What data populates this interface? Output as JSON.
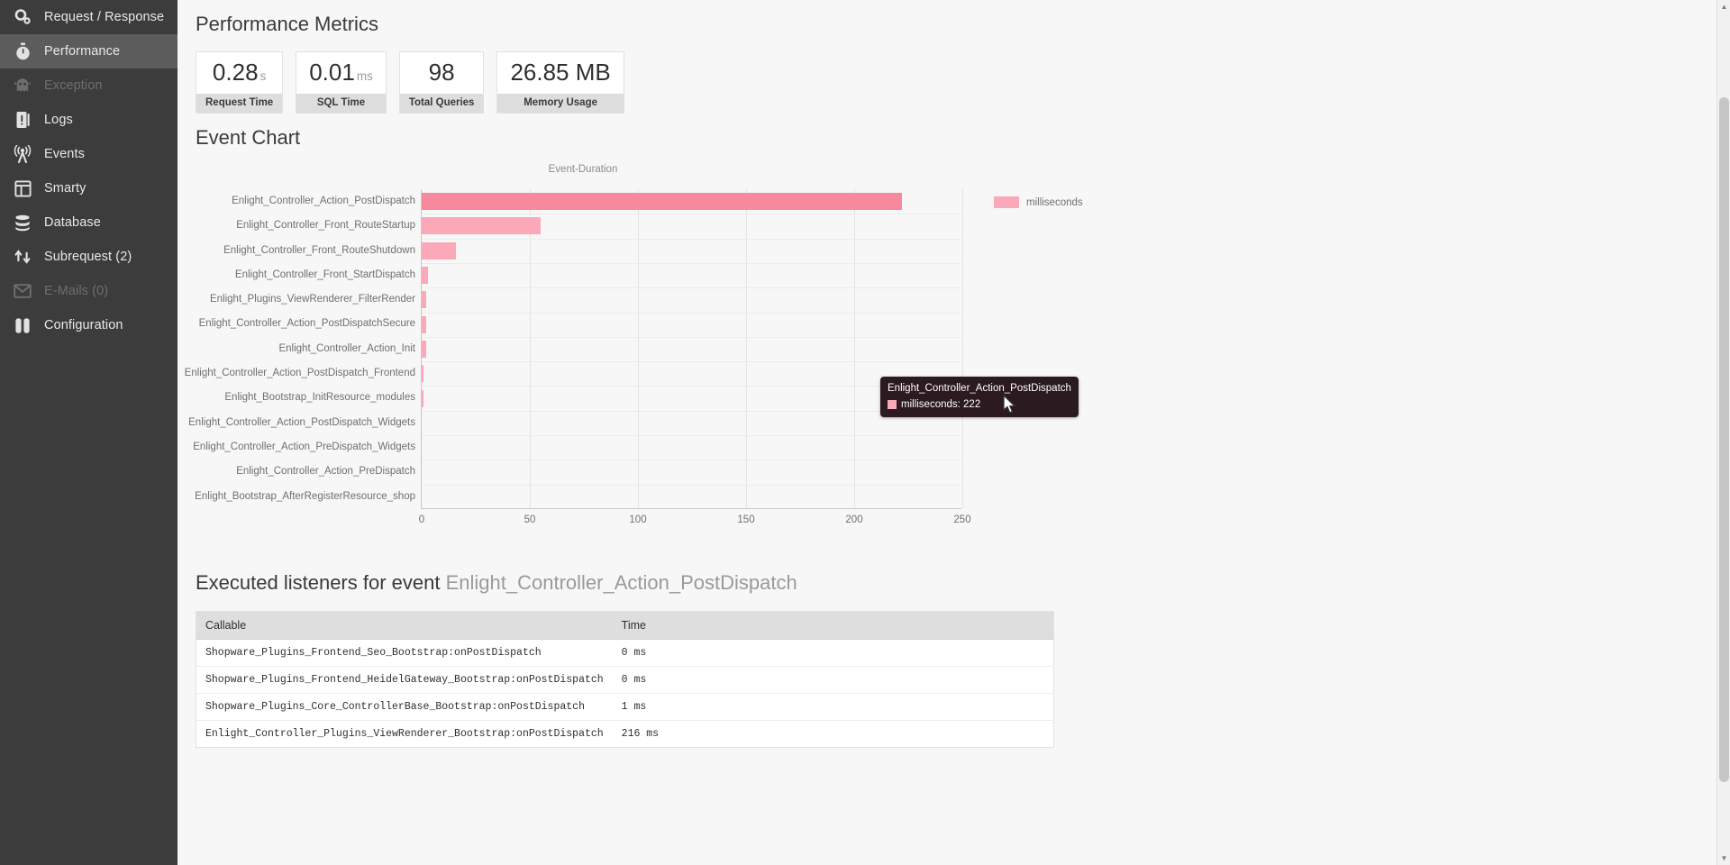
{
  "sidebar": {
    "items": [
      {
        "label": "Request / Response",
        "icon": "gears-icon",
        "state": "normal"
      },
      {
        "label": "Performance",
        "icon": "stopwatch-icon",
        "state": "active"
      },
      {
        "label": "Exception",
        "icon": "ghost-icon",
        "state": "disabled"
      },
      {
        "label": "Logs",
        "icon": "log-alert-icon",
        "state": "normal"
      },
      {
        "label": "Events",
        "icon": "broadcast-icon",
        "state": "normal"
      },
      {
        "label": "Smarty",
        "icon": "layout-icon",
        "state": "normal"
      },
      {
        "label": "Database",
        "icon": "database-icon",
        "state": "normal"
      },
      {
        "label": "Subrequest (2)",
        "icon": "subrequest-icon",
        "state": "normal"
      },
      {
        "label": "E-Mails (0)",
        "icon": "envelope-icon",
        "state": "disabled"
      },
      {
        "label": "Configuration",
        "icon": "config-icon",
        "state": "normal"
      }
    ]
  },
  "performance": {
    "title": "Performance Metrics",
    "metrics": [
      {
        "value": "0.28",
        "unit": "s",
        "caption": "Request Time"
      },
      {
        "value": "0.01",
        "unit": "ms",
        "caption": "SQL Time"
      },
      {
        "value": "98",
        "unit": "",
        "caption": "Total Queries"
      },
      {
        "value": "26.85 MB",
        "unit": "",
        "caption": "Memory Usage"
      }
    ]
  },
  "event_chart": {
    "title": "Event Chart",
    "tooltip": {
      "title": "Enlight_Controller_Action_PostDispatch",
      "series_label": "milliseconds",
      "value": "222",
      "text": "milliseconds: 222"
    }
  },
  "chart_data": {
    "type": "bar",
    "orientation": "horizontal",
    "title": "Event-Duration",
    "xlabel": "",
    "ylabel": "",
    "xlim": [
      0,
      250
    ],
    "xticks": [
      0,
      50,
      100,
      150,
      200,
      250
    ],
    "grid": true,
    "legend": {
      "position": "right",
      "entries": [
        "milliseconds"
      ]
    },
    "series_name": "milliseconds",
    "bar_color": "#fba8b8",
    "highlight_color": "#f7899f",
    "highlighted_index": 0,
    "categories": [
      "Enlight_Controller_Action_PostDispatch",
      "Enlight_Controller_Front_RouteStartup",
      "Enlight_Controller_Front_RouteShutdown",
      "Enlight_Controller_Front_StartDispatch",
      "Enlight_Plugins_ViewRenderer_FilterRender",
      "Enlight_Controller_Action_PostDispatchSecure",
      "Enlight_Controller_Action_Init",
      "Enlight_Controller_Action_PostDispatch_Frontend",
      "Enlight_Bootstrap_InitResource_modules",
      "Enlight_Controller_Action_PostDispatch_Widgets",
      "Enlight_Controller_Action_PreDispatch_Widgets",
      "Enlight_Controller_Action_PreDispatch",
      "Enlight_Bootstrap_AfterRegisterResource_shop"
    ],
    "values": [
      222,
      55,
      16,
      3,
      2,
      2,
      2,
      1,
      1,
      0,
      0,
      0,
      0
    ]
  },
  "listeners": {
    "title_prefix": "Executed listeners for event",
    "event_name": "Enlight_Controller_Action_PostDispatch",
    "columns": [
      "Callable",
      "Time"
    ],
    "rows": [
      {
        "callable": "Shopware_Plugins_Frontend_Seo_Bootstrap:onPostDispatch",
        "time": "0 ms"
      },
      {
        "callable": "Shopware_Plugins_Frontend_HeidelGateway_Bootstrap:onPostDispatch",
        "time": "0 ms"
      },
      {
        "callable": "Shopware_Plugins_Core_ControllerBase_Bootstrap:onPostDispatch",
        "time": "1 ms"
      },
      {
        "callable": "Enlight_Controller_Plugins_ViewRenderer_Bootstrap:onPostDispatch",
        "time": "216 ms"
      }
    ]
  },
  "colors": {
    "sidebar_bg": "#3c3c3c",
    "sidebar_active": "#5c5c5c",
    "page_bg": "#f7f7f7",
    "bar": "#fba8b8",
    "bar_highlight": "#f7899f",
    "tooltip_bg": "#2b1a1f"
  }
}
